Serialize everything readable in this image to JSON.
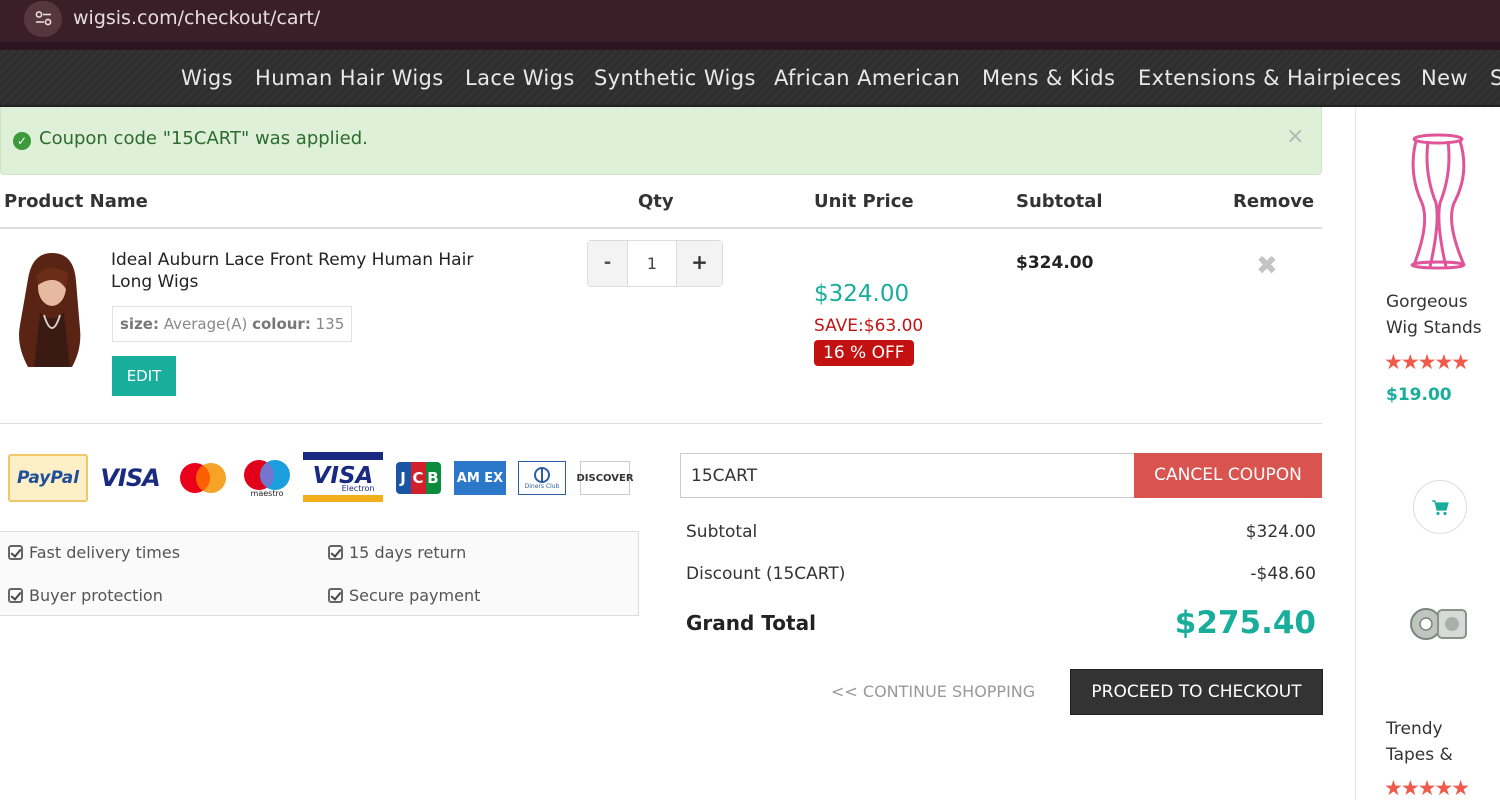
{
  "browser": {
    "url": "wigsis.com/checkout/cart/"
  },
  "nav": {
    "items": [
      "Wigs",
      "Human Hair Wigs",
      "Lace Wigs",
      "Synthetic Wigs",
      "African American",
      "Mens & Kids",
      "Extensions & Hairpieces",
      "New",
      "S"
    ]
  },
  "alert": {
    "message": "Coupon code \"15CART\" was applied.",
    "close": "×"
  },
  "table": {
    "headers": {
      "product": "Product Name",
      "qty": "Qty",
      "unit_price": "Unit Price",
      "subtotal": "Subtotal",
      "remove": "Remove"
    }
  },
  "item": {
    "name": "Ideal Auburn Lace Front Remy Human Hair Long Wigs",
    "size_label": "size:",
    "size_value": "Average(A)",
    "colour_label": "colour:",
    "colour_value": "135",
    "edit": "EDIT",
    "qty_minus": "-",
    "qty": "1",
    "qty_plus": "+",
    "unit_price": "$324.00",
    "save": "SAVE:$63.00",
    "off": "16 % OFF",
    "subtotal": "$324.00",
    "remove": "✖"
  },
  "payments": {
    "paypal": "PayPal",
    "visa": "VISA",
    "visa_electron": "VISA",
    "visa_electron_sub": "Electron",
    "maestro_sub": "maestro",
    "jcb": "JCB",
    "amex": "AM EX",
    "diners": "Diners Club",
    "discover": "DISCOVER"
  },
  "features": [
    "Fast delivery times",
    "15 days return",
    "Buyer protection",
    "Secure payment"
  ],
  "coupon": {
    "value": "15CART",
    "cancel": "CANCEL COUPON"
  },
  "totals": {
    "subtotal_label": "Subtotal",
    "subtotal": "$324.00",
    "discount_label": "Discount (15CART)",
    "discount": "-$48.60",
    "grand_label": "Grand Total",
    "grand": "$275.40"
  },
  "actions": {
    "continue": "<< CONTINUE SHOPPING",
    "checkout": "PROCEED TO CHECKOUT"
  },
  "sidebar": {
    "product1": {
      "title_line1": "Gorgeous",
      "title_line2": "Wig Stands",
      "stars": "★★★★★",
      "price": "$19.00",
      "rating_fraction": 1.0
    },
    "product2": {
      "title_line1": "Trendy",
      "title_line2": "Tapes &",
      "stars": "★★★★★",
      "rating_fraction": 1.0
    }
  },
  "colors": {
    "accent": "#19ad9b",
    "danger": "#d9534f",
    "sale": "#c31010",
    "nav_bg": "#333333",
    "browser_bg": "#3a1f29"
  },
  "icons": [
    "site-settings-icon",
    "check-circle-icon",
    "close-icon",
    "remove-icon",
    "checkbox-icon",
    "cart-icon",
    "wig-stand-image",
    "tape-rolls-image"
  ]
}
